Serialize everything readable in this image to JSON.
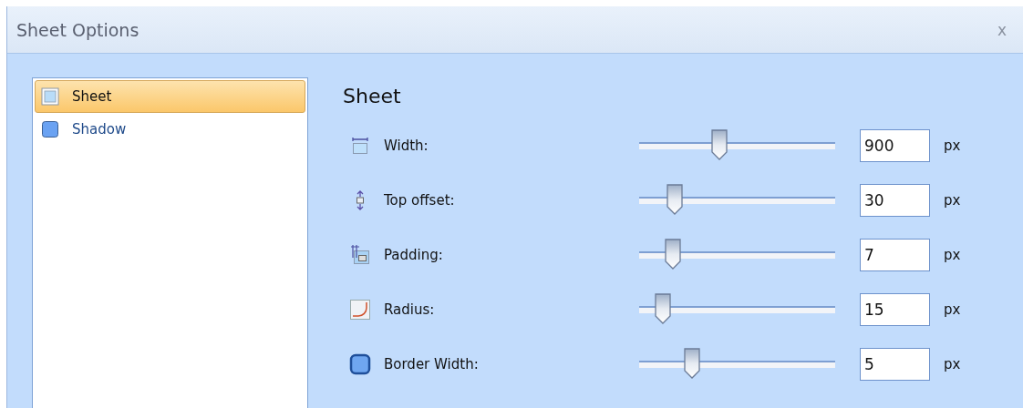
{
  "window": {
    "title": "Sheet Options",
    "close": "x"
  },
  "sidebar": {
    "items": [
      {
        "label": "Sheet",
        "selected": true,
        "kind": "outline"
      },
      {
        "label": "Shadow",
        "selected": false,
        "kind": "filled"
      }
    ]
  },
  "panel": {
    "heading": "Sheet",
    "settings": [
      {
        "kind": "width",
        "label": "Width:",
        "level": 0.41,
        "value": "900",
        "unit": "px"
      },
      {
        "kind": "offset",
        "label": "Top offset:",
        "level": 0.18,
        "value": "30",
        "unit": "px"
      },
      {
        "kind": "padding",
        "label": "Padding:",
        "level": 0.17,
        "value": "7",
        "unit": "px"
      },
      {
        "kind": "radius",
        "label": "Radius:",
        "level": 0.12,
        "value": "15",
        "unit": "px"
      },
      {
        "kind": "border",
        "label": "Border Width:",
        "level": 0.27,
        "value": "5",
        "unit": "px"
      }
    ]
  }
}
